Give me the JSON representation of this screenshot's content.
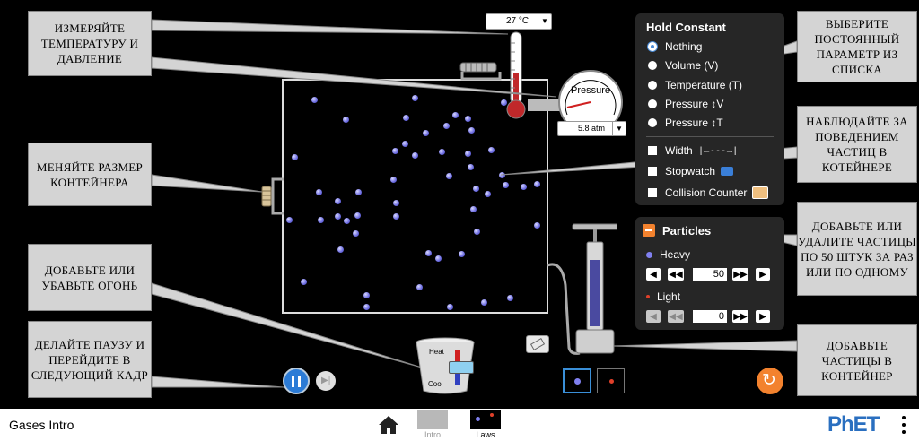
{
  "sim": {
    "temperature_readout": "27 °C",
    "pressure_label": "Pressure",
    "pressure_readout": "5.8 atm",
    "heat_label": "Heat",
    "cool_label": "Cool"
  },
  "hold_constant": {
    "title": "Hold Constant",
    "options": [
      {
        "label": "Nothing",
        "selected": true
      },
      {
        "label": "Volume (V)",
        "selected": false
      },
      {
        "label": "Temperature (T)",
        "selected": false
      },
      {
        "label": "Pressure ↕V",
        "selected": false
      },
      {
        "label": "Pressure ↕T",
        "selected": false
      }
    ],
    "width_label": "Width",
    "width_symbol": "|←- - -→|",
    "stopwatch_label": "Stopwatch",
    "collision_label": "Collision Counter"
  },
  "particles": {
    "title": "Particles",
    "heavy_label": "Heavy",
    "heavy_count": "50",
    "light_label": "Light",
    "light_count": "0"
  },
  "callouts": {
    "measure": "ИЗМЕРЯЙТЕ ТЕМПЕРАТУРУ И ДАВЛЕНИЕ",
    "resize": "МЕНЯЙТЕ РАЗМЕР КОНТЕЙНЕРА",
    "fire": "ДОБАВЬТЕ ИЛИ УБАВЬТЕ ОГОНЬ",
    "pause": "ДЕЛАЙТЕ ПАУЗУ И ПЕРЕЙДИТЕ В СЛЕДУЮЩИЙ КАДР",
    "choose": "ВЫБЕРИТЕ ПОСТОЯННЫЙ ПАРАМЕТР ИЗ СПИСКА",
    "observe": "НАБЛЮДАЙТЕ ЗА ПОВЕДЕНИЕМ ЧАСТИЦ В КОТЕЙНЕРЕ",
    "add_remove": "ДОБАВЬТЕ ИЛИ УДАЛИТЕ ЧАСТИЦЫ ПО 50 ШТУК ЗА РАЗ ИЛИ ПО ОДНОМУ",
    "add_particles": "ДОБАВЬТЕ ЧАСТИЦЫ В КОНТЕЙНЕР"
  },
  "navbar": {
    "title": "Gases Intro",
    "screens": [
      {
        "label": "Intro",
        "active": false
      },
      {
        "label": "Laws",
        "active": true
      }
    ],
    "brand": "PhET"
  },
  "colors": {
    "accent_orange": "#f3822e",
    "heavy_particle": "#6a6ae0",
    "light_particle": "#e0402a",
    "pause_blue": "#2b7bd6",
    "panel_bg": "#262626"
  }
}
